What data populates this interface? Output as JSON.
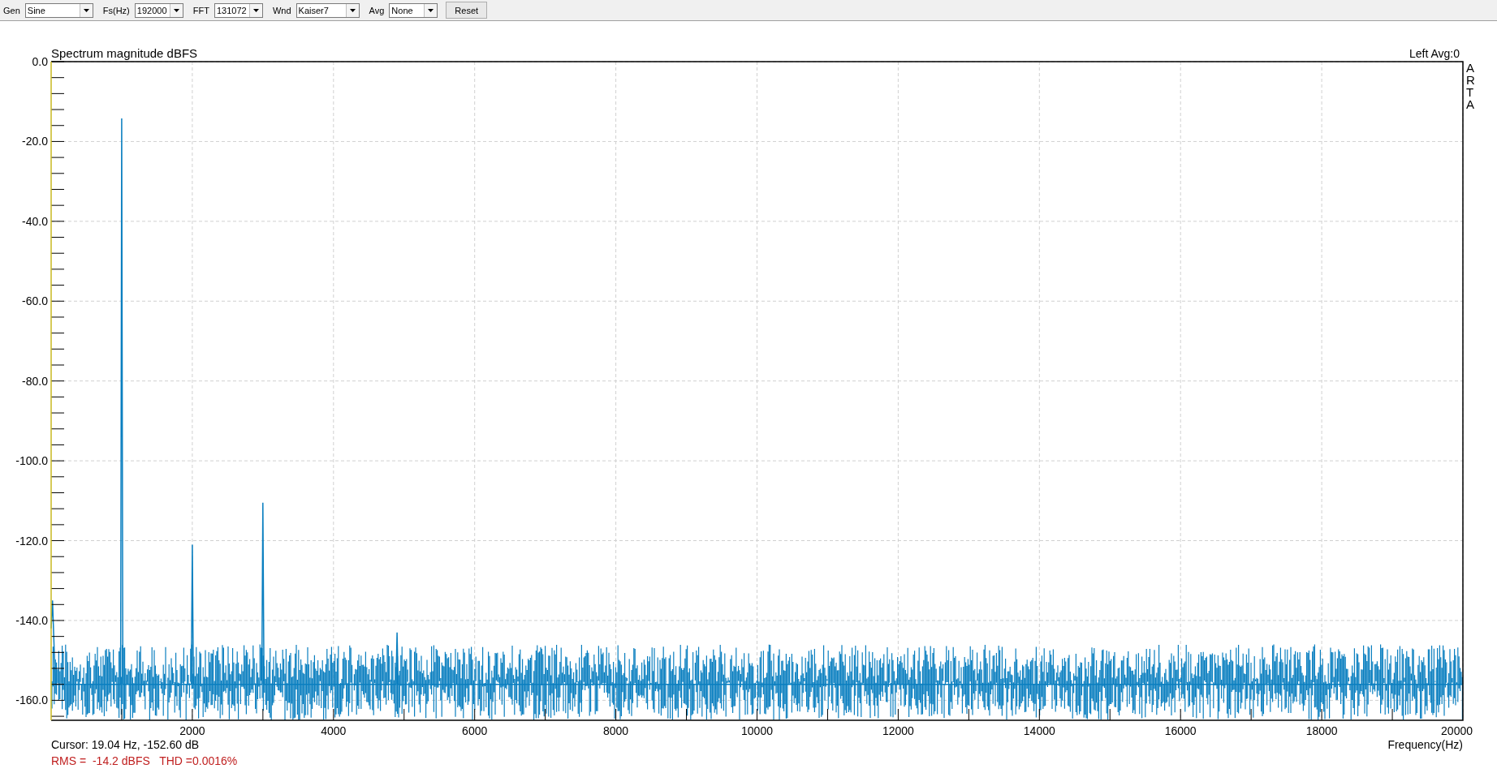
{
  "toolbar": [
    {
      "kind": "combo",
      "label": "Gen",
      "value": "Sine"
    },
    {
      "kind": "combo",
      "label": "Fs(Hz)",
      "value": "192000"
    },
    {
      "kind": "combo",
      "label": "FFT",
      "value": "131072"
    },
    {
      "kind": "combo",
      "label": "Wnd",
      "value": "Kaiser7"
    },
    {
      "kind": "combo",
      "label": "Avg",
      "value": "None"
    },
    {
      "kind": "button",
      "label": "Reset"
    }
  ],
  "chart": {
    "channel_info": "Left  Avg:0",
    "side_label": "ARTA",
    "chart_data": {
      "type": "line",
      "title": "Spectrum magnitude dBFS",
      "xlabel": "Frequency(Hz)",
      "xlim": [
        0,
        20000
      ],
      "ylim": [
        -165,
        0
      ],
      "grid": true,
      "xticks": [
        2000,
        4000,
        6000,
        8000,
        10000,
        12000,
        14000,
        16000,
        18000,
        20000
      ],
      "yticks": [
        {
          "value": 0,
          "label": "0.0"
        },
        {
          "value": -20,
          "label": "-20.0"
        },
        {
          "value": -40,
          "label": "-40.0"
        },
        {
          "value": -60,
          "label": "-60.0"
        },
        {
          "value": -80,
          "label": "-80.0"
        },
        {
          "value": -100,
          "label": "-100.0"
        },
        {
          "value": -120,
          "label": "-120.0"
        },
        {
          "value": -140,
          "label": "-140.0"
        },
        {
          "value": -160,
          "label": "-160.0"
        }
      ],
      "x": [
        0,
        19.04,
        60,
        985,
        1000,
        1015,
        1985,
        2000,
        2015,
        2985,
        3000,
        3015,
        4885,
        4900,
        4915,
        6000,
        8000,
        10000,
        12000,
        14000,
        16000,
        18000,
        20000
      ],
      "series": [
        {
          "color": "#0a7fc0",
          "values": [
            -142,
            -135,
            -156,
            -156,
            -14.2,
            -156,
            -156,
            -121,
            -156,
            -156,
            -110.5,
            -156,
            -156,
            -143,
            -156,
            -156,
            -156,
            -156,
            -156,
            -156,
            -156,
            -156,
            -156
          ]
        }
      ]
    }
  },
  "cursor": "Cursor: 19.04 Hz, -152.60 dB",
  "measurement": "RMS =  -14.2 dBFS   THD =0.0016%"
}
